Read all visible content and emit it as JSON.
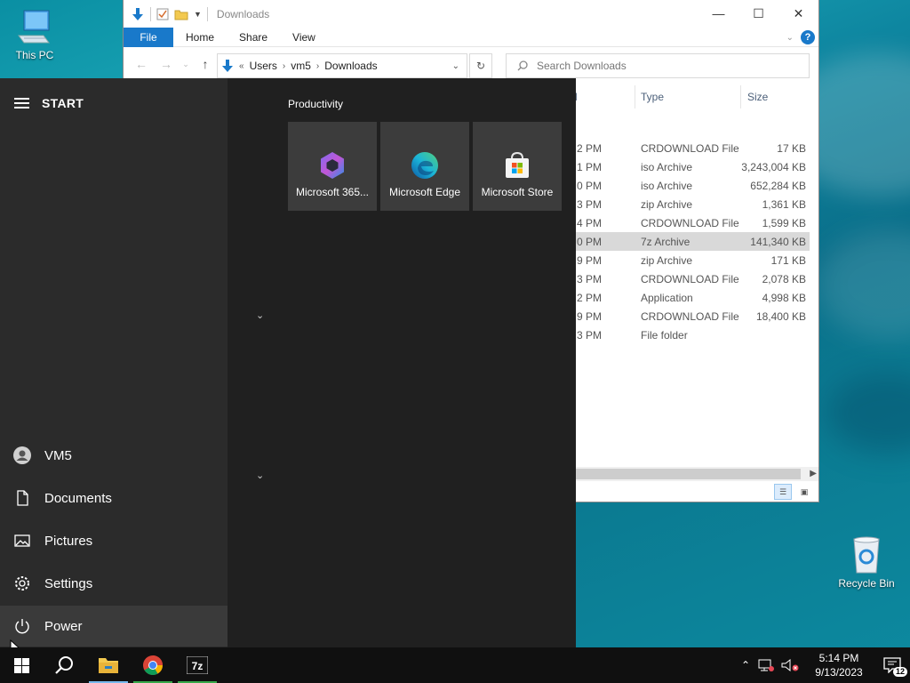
{
  "desktop": {
    "icons": [
      {
        "label": "This PC"
      },
      {
        "label": "Recycle Bin"
      }
    ]
  },
  "explorer": {
    "title": "Downloads",
    "ribbon_tabs": [
      "File",
      "Home",
      "Share",
      "View"
    ],
    "help": "?",
    "breadcrumb": {
      "prefix": "«",
      "items": [
        "Users",
        "vm5",
        "Downloads"
      ]
    },
    "search_placeholder": "Search Downloads",
    "columns": {
      "date_fragment": "d",
      "type": "Type",
      "size": "Size"
    },
    "files": [
      {
        "date": "2 PM",
        "type": "CRDOWNLOAD File",
        "size": "17 KB",
        "selected": false
      },
      {
        "date": "1 PM",
        "type": "iso Archive",
        "size": "3,243,004 KB",
        "selected": false
      },
      {
        "date": "0 PM",
        "type": "iso Archive",
        "size": "652,284 KB",
        "selected": false
      },
      {
        "date": "3 PM",
        "type": "zip Archive",
        "size": "1,361 KB",
        "selected": false
      },
      {
        "date": "4 PM",
        "type": "CRDOWNLOAD File",
        "size": "1,599 KB",
        "selected": false
      },
      {
        "date": "0 PM",
        "type": "7z Archive",
        "size": "141,340 KB",
        "selected": true
      },
      {
        "date": "9 PM",
        "type": "zip Archive",
        "size": "171 KB",
        "selected": false
      },
      {
        "date": "3 PM",
        "type": "CRDOWNLOAD File",
        "size": "2,078 KB",
        "selected": false
      },
      {
        "date": "2 PM",
        "type": "Application",
        "size": "4,998 KB",
        "selected": false
      },
      {
        "date": "9 PM",
        "type": "CRDOWNLOAD File",
        "size": "18,400 KB",
        "selected": false
      },
      {
        "date": "3 PM",
        "type": "File folder",
        "size": "",
        "selected": false
      }
    ]
  },
  "start_menu": {
    "title": "START",
    "group_label": "Productivity",
    "tiles": [
      {
        "label": "Microsoft 365...",
        "icon": "microsoft-365-icon"
      },
      {
        "label": "Microsoft Edge",
        "icon": "edge-icon"
      },
      {
        "label": "Microsoft Store",
        "icon": "store-icon"
      }
    ],
    "left_items": [
      {
        "label": "VM5",
        "icon": "user-icon"
      },
      {
        "label": "Documents",
        "icon": "document-icon"
      },
      {
        "label": "Pictures",
        "icon": "pictures-icon"
      },
      {
        "label": "Settings",
        "icon": "gear-icon"
      },
      {
        "label": "Power",
        "icon": "power-icon"
      }
    ]
  },
  "taskbar": {
    "apps": [
      "start-button",
      "search-button",
      "file-explorer",
      "chrome",
      "7zip"
    ],
    "clock_time": "5:14 PM",
    "clock_date": "9/13/2023",
    "notification_count": "12",
    "accent": "#1979ca"
  }
}
